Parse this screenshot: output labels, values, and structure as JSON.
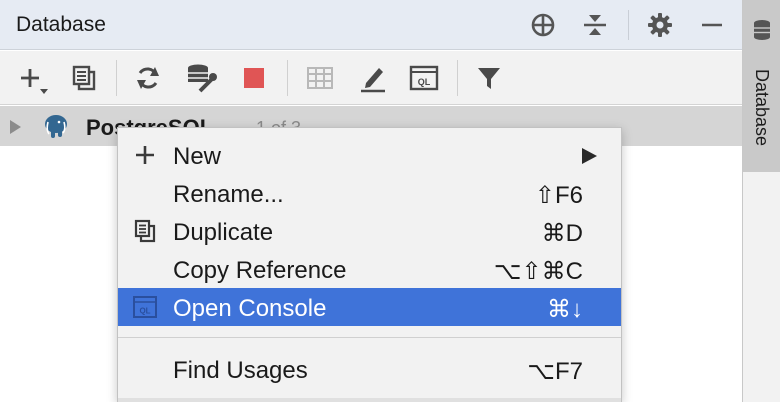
{
  "panel": {
    "title": "Database"
  },
  "title_actions": [
    "crosshair-icon",
    "collapse-icon",
    "gear-icon",
    "minimize-icon"
  ],
  "toolbar": [
    "add-icon",
    "duplicate-icon",
    "refresh-icon",
    "data-source-properties-icon",
    "stop-icon",
    "table-icon",
    "edit-icon",
    "console-icon",
    "filter-icon"
  ],
  "tree": {
    "name": "PostgreSQL",
    "count": "1 of 3"
  },
  "side": {
    "label": "Database"
  },
  "context_menu": {
    "items": [
      {
        "label": "New",
        "shortcut": "",
        "icon": "plus-icon",
        "submenu": true
      },
      {
        "label": "Rename...",
        "shortcut": "⇧F6",
        "icon": "",
        "submenu": false
      },
      {
        "label": "Duplicate",
        "shortcut": "⌘D",
        "icon": "duplicate-icon",
        "submenu": false
      },
      {
        "label": "Copy Reference",
        "shortcut": "⌥⇧⌘C",
        "icon": "",
        "submenu": false
      },
      {
        "label": "Open Console",
        "shortcut": "⌘↓",
        "icon": "console-icon",
        "submenu": false,
        "selected": true
      },
      {
        "label": "Find Usages",
        "shortcut": "⌥F7",
        "icon": "",
        "submenu": false
      }
    ]
  },
  "colors": {
    "selection": "#3f73d9",
    "stop": "#e05555",
    "postgres": "#336791",
    "header": "#e6ebf3"
  }
}
